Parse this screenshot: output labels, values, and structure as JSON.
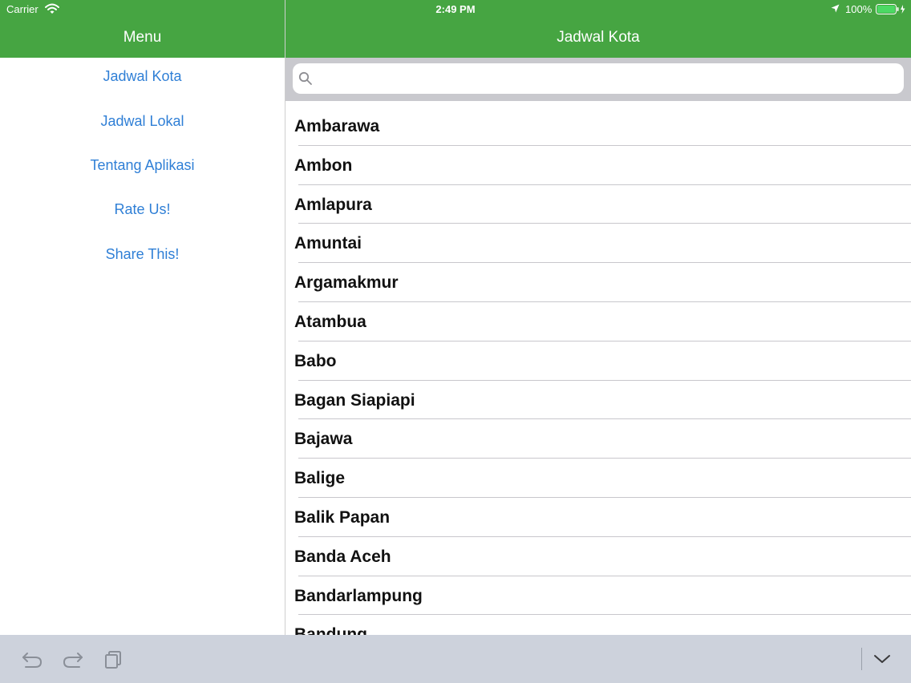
{
  "status_bar": {
    "carrier": "Carrier",
    "time": "2:49 PM",
    "battery": "100%"
  },
  "colors": {
    "header_green": "#46a542",
    "link_blue": "#2f7fd6",
    "search_bg": "#c9c9ce",
    "keyboard_bar": "#cdd2dc"
  },
  "sidebar": {
    "title": "Menu",
    "items": [
      {
        "label": "Jadwal Kota"
      },
      {
        "label": "Jadwal Lokal"
      },
      {
        "label": "Tentang Aplikasi"
      },
      {
        "label": "Rate Us!"
      },
      {
        "label": "Share This!"
      }
    ]
  },
  "main": {
    "title": "Jadwal Kota",
    "search": {
      "value": "",
      "placeholder": ""
    },
    "cities": [
      "Ambarawa",
      "Ambon",
      "Amlapura",
      "Amuntai",
      "Argamakmur",
      "Atambua",
      "Babo",
      "Bagan Siapiapi",
      "Bajawa",
      "Balige",
      "Balik Papan",
      "Banda Aceh",
      "Bandarlampung",
      "Bandung"
    ]
  },
  "keyboard_bar": {
    "icons": [
      "undo-icon",
      "redo-icon",
      "paste-icon",
      "dismiss-keyboard-icon"
    ]
  }
}
